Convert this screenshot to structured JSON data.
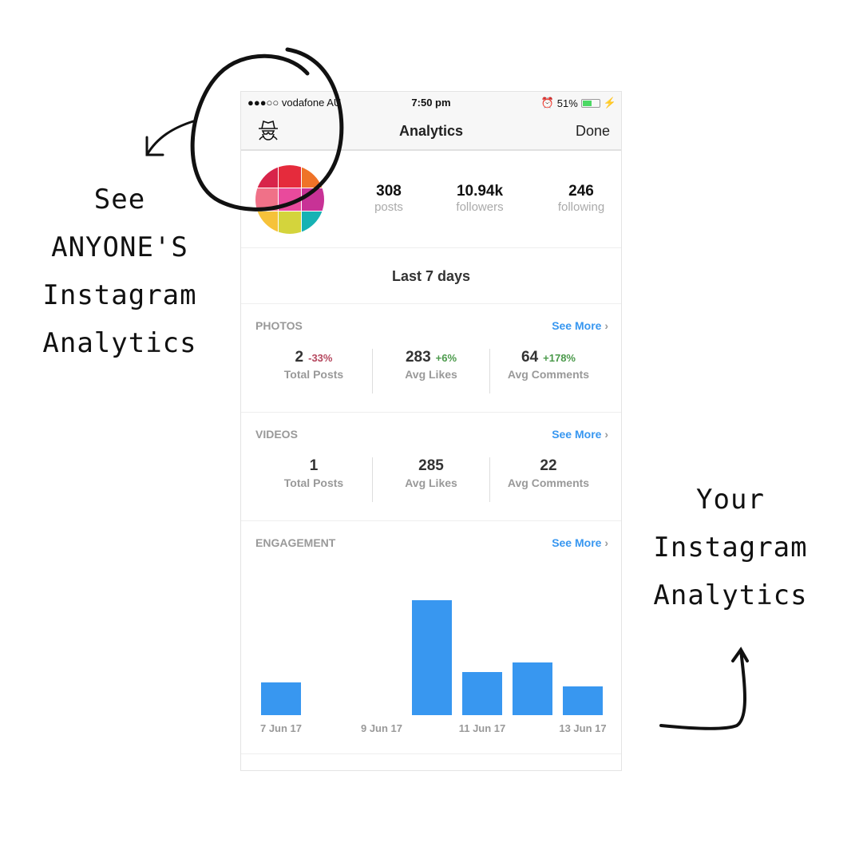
{
  "status": {
    "carrier": "●●●○○ vodafone AU",
    "time": "7:50 pm",
    "battery": "51%",
    "battery_level": 0.51
  },
  "nav": {
    "title": "Analytics",
    "done": "Done",
    "left_icon": "spy-icon"
  },
  "profile": {
    "posts": "308",
    "posts_label": "posts",
    "followers": "10.94k",
    "followers_label": "followers",
    "following": "246",
    "following_label": "following",
    "avatar_colors": [
      "#d8244a",
      "#e52b3c",
      "#ef7328",
      "#f07188",
      "#e94a9c",
      "#c83296",
      "#f6c23a",
      "#d4d43c",
      "#16b2b4"
    ]
  },
  "range": "Last 7 days",
  "photos": {
    "title": "PHOTOS",
    "see_more": "See More",
    "stats": [
      {
        "value": "2",
        "change": "-33%",
        "label": "Total Posts",
        "color": "#b5475e"
      },
      {
        "value": "283",
        "change": "+6%",
        "label": "Avg Likes",
        "color": "#4b9a4b"
      },
      {
        "value": "64",
        "change": "+178%",
        "label": "Avg Comments",
        "color": "#4b9a4b"
      }
    ]
  },
  "videos": {
    "title": "VIDEOS",
    "see_more": "See More",
    "stats": [
      {
        "value": "1",
        "label": "Total Posts"
      },
      {
        "value": "285",
        "label": "Avg Likes"
      },
      {
        "value": "22",
        "label": "Avg Comments"
      }
    ]
  },
  "engagement": {
    "title": "ENGAGEMENT",
    "see_more": "See More"
  },
  "chart_data": {
    "type": "bar",
    "categories": [
      "7 Jun 17",
      "8 Jun 17",
      "9 Jun 17",
      "10 Jun 17",
      "11 Jun 17",
      "12 Jun 17",
      "13 Jun 17"
    ],
    "tick_labels": [
      "7 Jun 17",
      "9 Jun 17",
      "11 Jun 17",
      "13 Jun 17"
    ],
    "values": [
      41,
      0,
      0,
      144,
      54,
      66,
      36
    ],
    "color": "#3897f0",
    "grid": false
  },
  "annotations": {
    "left": [
      "See",
      "ANYONE'S",
      "Instagram",
      "Analytics"
    ],
    "right": [
      "Your",
      "Instagram",
      "Analytics"
    ]
  }
}
